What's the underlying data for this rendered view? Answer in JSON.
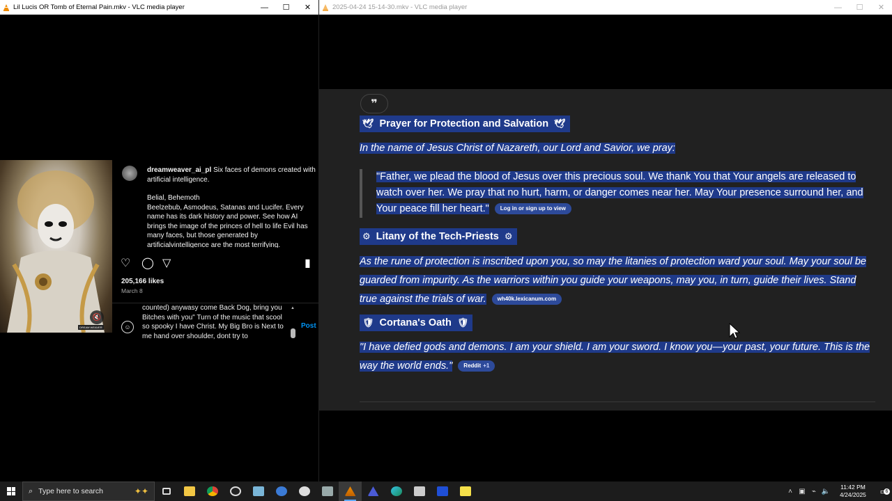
{
  "left_window": {
    "title": "Lil Lucis OR Tomb of Eternal Pain.mkv - VLC media player",
    "controls": {
      "minimize": "—",
      "maximize": "☐",
      "close": "✕"
    }
  },
  "right_window": {
    "title": "2025-04-24 15-14-30.mkv - VLC media player",
    "controls": {
      "minimize": "—",
      "maximize": "☐",
      "close": "✕"
    }
  },
  "instagram": {
    "image_watermark": "DREAM WEAVER",
    "username": "dreamweaver_ai_pl",
    "caption_first": "Six faces of demons created with artificial intelligence.",
    "caption_names": "Belial, Behemoth",
    "caption_rest": "Beelzebub, Asmodeus, Satanas and Lucifer. Every name has its dark history and power. See how AI brings the image of the princes of hell to life Evil has many faces, but those generated by artificialvintelligence are the most terrifying.",
    "likes": "205,166 likes",
    "date": "March 8",
    "comment_draft": "counted) anywasy come Back Dog, bring you Bitches with you\" Turn of the music that scool so spooky I have Christ. My Big Bro is Next to me hand over shoulder, dont try to",
    "post_label": "Post",
    "icons": {
      "like": "♡",
      "comment": "◯",
      "share": "▽",
      "save": "▮",
      "mute": "🔇",
      "emoji": "☺"
    }
  },
  "chat": {
    "quote_icon": "❞",
    "sections": [
      {
        "heading": "Prayer for Protection and Salvation",
        "icon": "🕊",
        "intro": "In the name of Jesus Christ of Nazareth, our Lord and Savior, we pray:",
        "quote": "\"Father, we plead the blood of Jesus over this precious soul. We thank You that Your angels are released to watch over her. We pray that no hurt, harm, or danger comes near her. May Your presence surround her, and Your peace fill her heart.\"",
        "source": "Log in or sign up to view"
      },
      {
        "heading": "Litany of the Tech-Priests",
        "icon": "⚙",
        "body": "As the rune of protection is inscribed upon you, so may the litanies of protection ward your soul. May your soul be guarded from impurity. As the warriors within you guide your weapons, may you, in turn, guide their lives. Stand true against the trials of war.",
        "source": "wh40k.lexicanum.com"
      },
      {
        "heading": "Cortana's Oath",
        "icon": "🛡",
        "body": "\"I have defied gods and demons. I am your shield. I am your sword. I know you—your past, your future. This is the way the world ends.\"",
        "source": "Reddit",
        "source_extra": "+1"
      }
    ]
  },
  "taskbar": {
    "search_placeholder": "Type here to search",
    "time": "11:42 PM",
    "date": "4/24/2025",
    "notification_count": "6",
    "colors": {
      "accent": "#5ea9ff",
      "selection": "#1f3a8a",
      "chip": "#2d4a9a"
    }
  }
}
